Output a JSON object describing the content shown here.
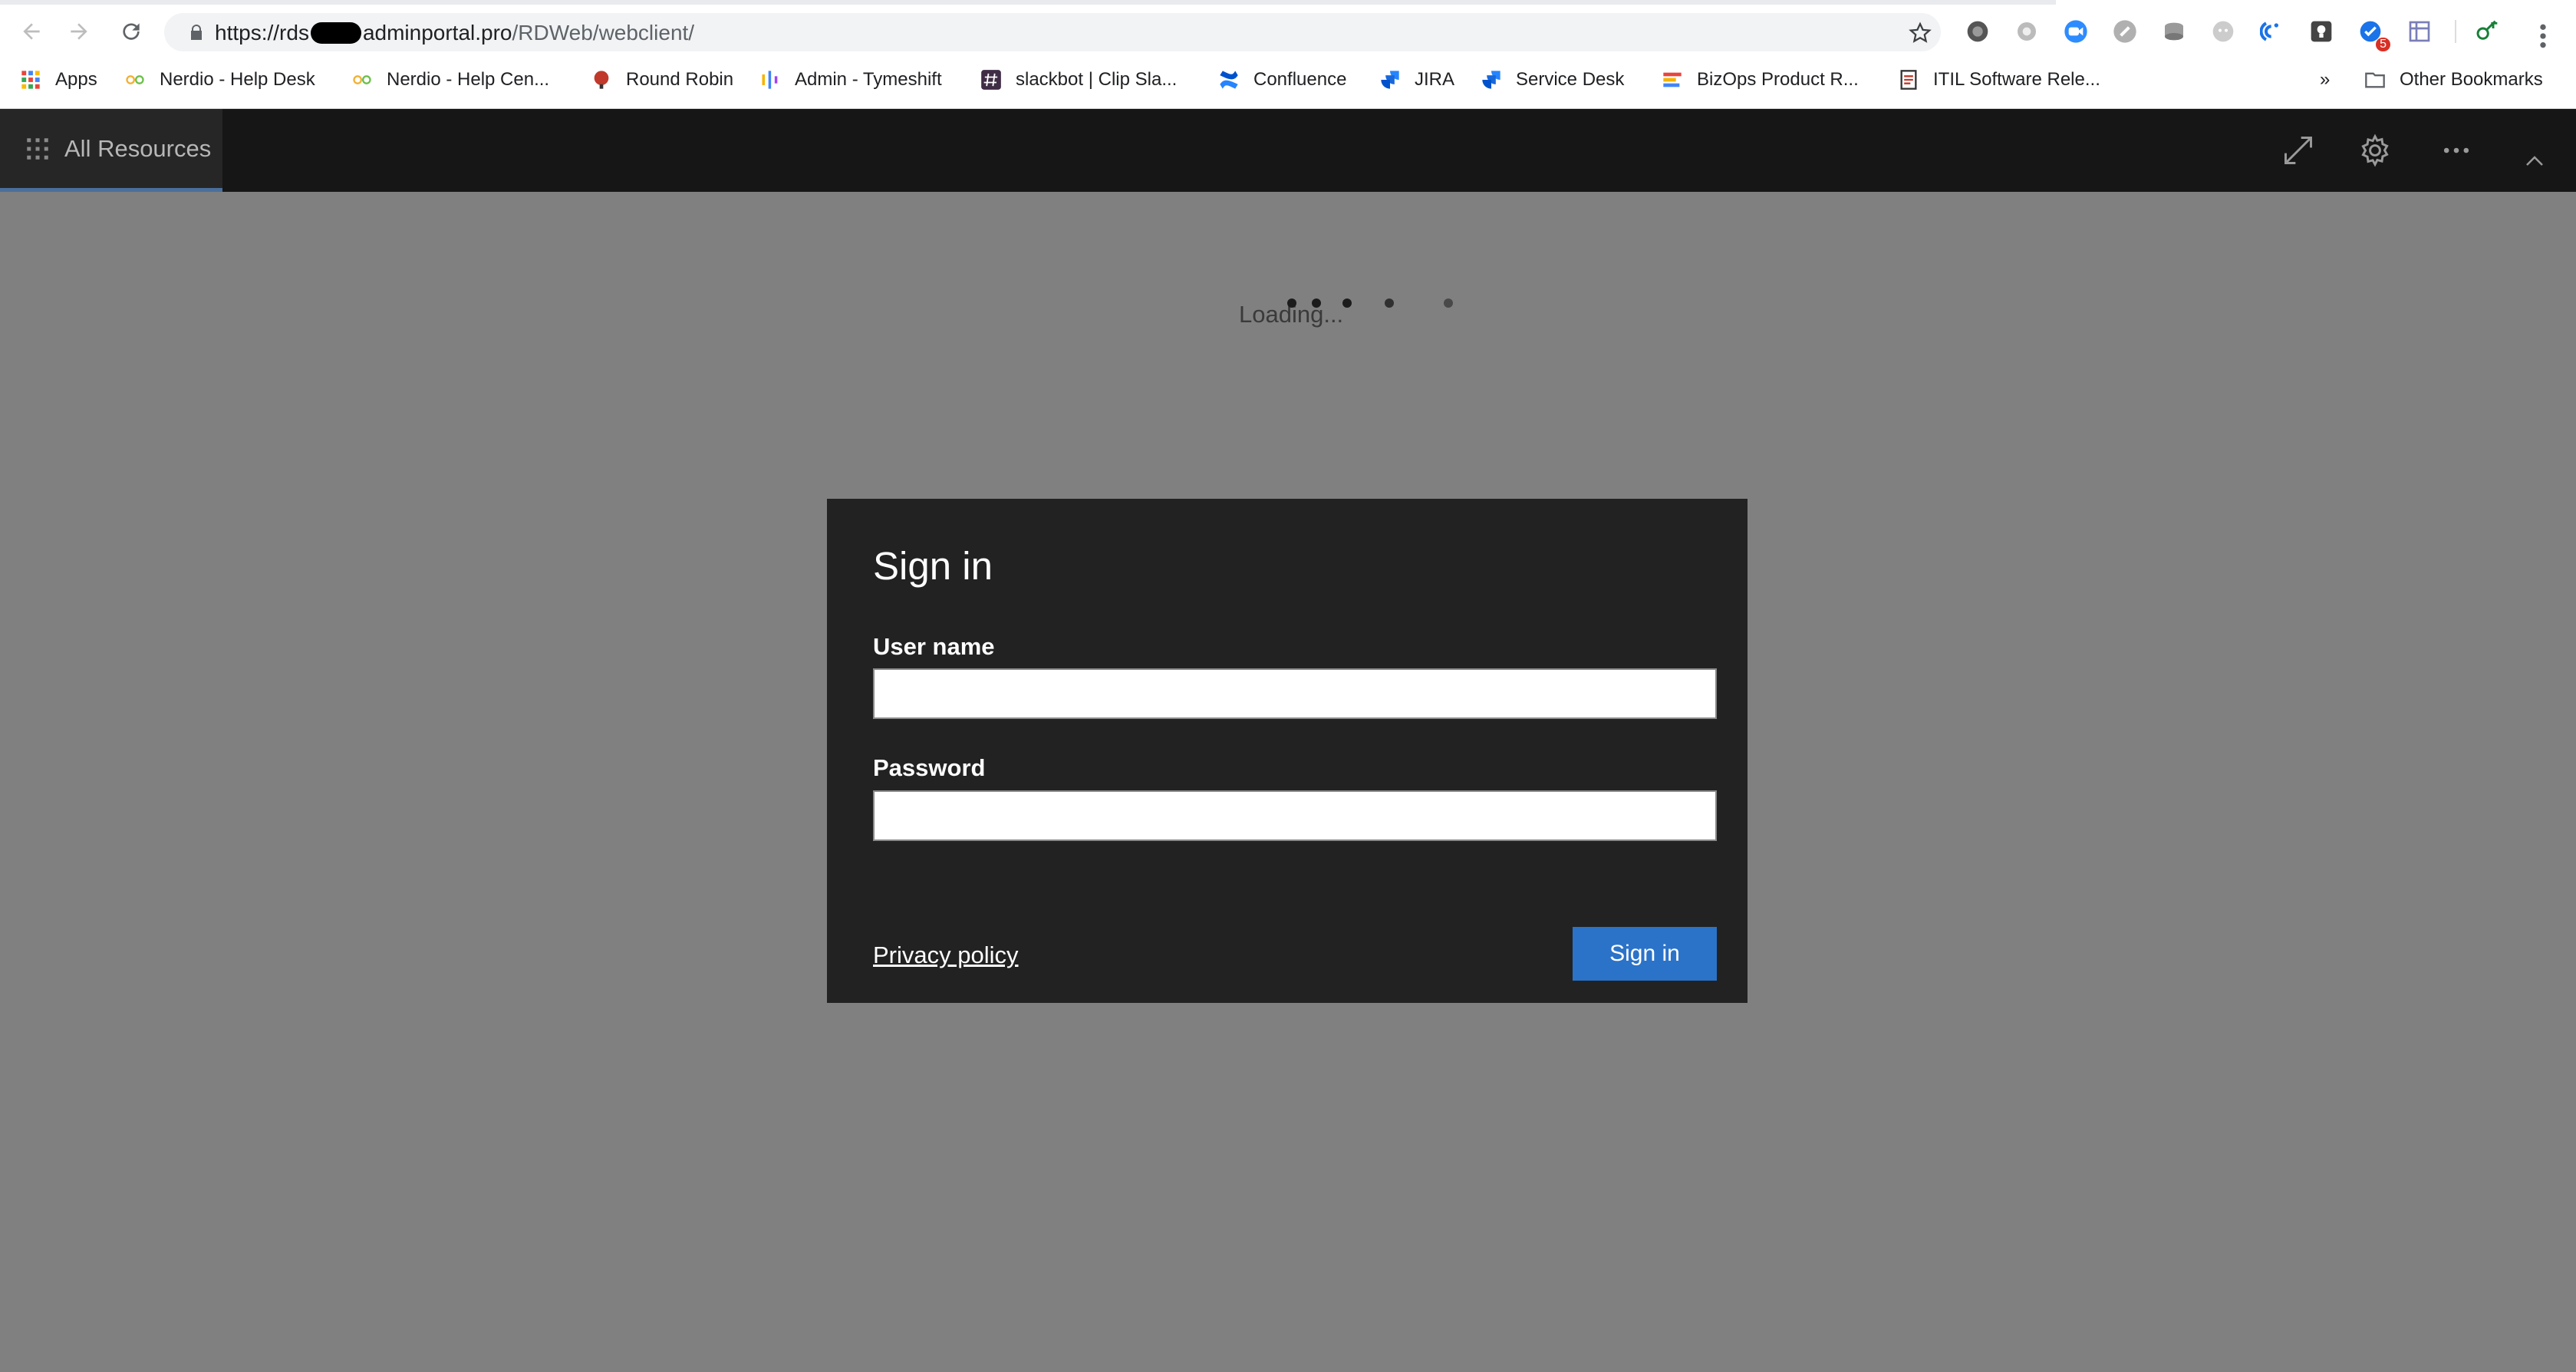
{
  "browser": {
    "url": {
      "prefix": "https://rds",
      "domain_rest": "adminportal.pro",
      "path": "/RDWeb/webclient/"
    },
    "extensions": [
      "globe-icon",
      "circle-icon",
      "video-icon",
      "link-icon",
      "database-icon",
      "ghost-icon",
      "gauge-icon",
      "lightbulb-icon",
      "check-badge-icon",
      "grid-icon",
      "key-icon"
    ],
    "badge_count": "5",
    "bookmarks": [
      {
        "label": "Apps",
        "icon": "apps-grid-icon"
      },
      {
        "label": "Nerdio - Help Desk",
        "icon": "nerdio-icon"
      },
      {
        "label": "Nerdio - Help Cen...",
        "icon": "nerdio-icon"
      },
      {
        "label": "Round Robin",
        "icon": "round-robin-icon"
      },
      {
        "label": "Admin - Tymeshift",
        "icon": "tymeshift-icon"
      },
      {
        "label": "slackbot | Clip Sla...",
        "icon": "hash-icon"
      },
      {
        "label": "Confluence",
        "icon": "confluence-icon"
      },
      {
        "label": "JIRA",
        "icon": "jira-icon"
      },
      {
        "label": "Service Desk",
        "icon": "jira-icon"
      },
      {
        "label": "BizOps Product R...",
        "icon": "bizops-icon"
      },
      {
        "label": "ITIL Software Rele...",
        "icon": "document-icon"
      }
    ],
    "more_bookmarks": "»",
    "other_bookmarks": "Other Bookmarks"
  },
  "app": {
    "all_resources": "All Resources",
    "loading": "Loading..."
  },
  "signin": {
    "title": "Sign in",
    "username_label": "User name",
    "username_value": "",
    "password_label": "Password",
    "password_value": "",
    "privacy": "Privacy policy",
    "button": "Sign in"
  },
  "colors": {
    "page_bg": "#808080",
    "appbar_bg": "#161616",
    "dialog_bg": "#222222",
    "accent": "#2b73c8"
  }
}
